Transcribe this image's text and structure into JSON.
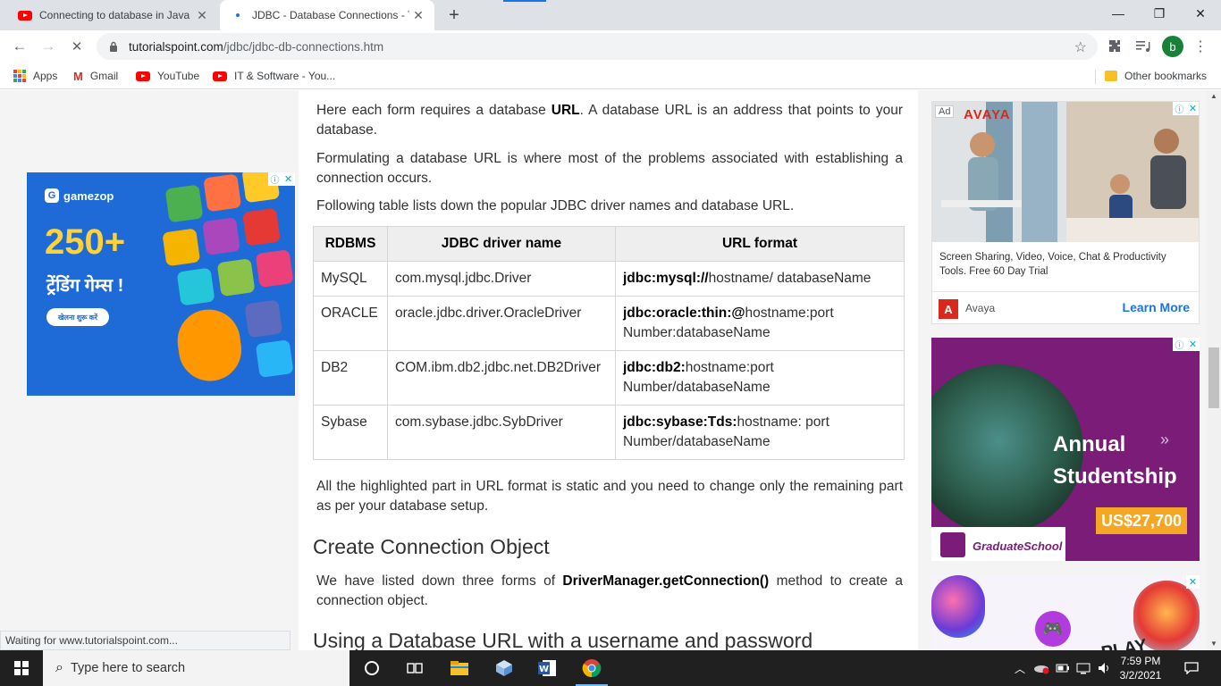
{
  "browser": {
    "tabs": [
      {
        "title": "Connecting to database in Java M",
        "icon": "youtube-icon"
      },
      {
        "title": "JDBC - Database Connections - T",
        "icon": "loading-icon"
      }
    ],
    "new_tab": "+",
    "window_controls": {
      "minimize": "—",
      "maximize": "❐",
      "close": "✕"
    },
    "nav": {
      "back": "←",
      "forward": "→",
      "stop": "✕"
    },
    "url": {
      "host": "tutorialspoint.com",
      "path": "/jdbc/jdbc-db-connections.htm"
    },
    "profile_initial": "b",
    "bookmarks": [
      "Apps",
      "Gmail",
      "YouTube",
      "IT & Software - You..."
    ],
    "other_bookmarks": "Other bookmarks",
    "status_text": "Waiting for www.tutorialspoint.com..."
  },
  "article": {
    "p1": {
      "pre": "Here each form requires a database ",
      "bold": "URL",
      "post": ". A database URL is an address that points to your database."
    },
    "p2": "Formulating a database URL is where most of the problems associated with establishing a connection occurs.",
    "p3": "Following table lists down the popular JDBC driver names and database URL.",
    "table": {
      "headers": [
        "RDBMS",
        "JDBC driver name",
        "URL format"
      ],
      "rows": [
        {
          "rdbms": "MySQL",
          "driver": "com.mysql.jdbc.Driver",
          "url_bold": "jdbc:mysql://",
          "url_rest": "hostname/ databaseName"
        },
        {
          "rdbms": "ORACLE",
          "driver": "oracle.jdbc.driver.OracleDriver",
          "url_bold": "jdbc:oracle:thin:@",
          "url_rest": "hostname:port Number:databaseName"
        },
        {
          "rdbms": "DB2",
          "driver": "COM.ibm.db2.jdbc.net.DB2Driver",
          "url_bold": "jdbc:db2:",
          "url_rest": "hostname:port Number/databaseName"
        },
        {
          "rdbms": "Sybase",
          "driver": "com.sybase.jdbc.SybDriver",
          "url_bold": "jdbc:sybase:Tds:",
          "url_rest": "hostname: port Number/databaseName"
        }
      ]
    },
    "p4": "All the highlighted part in URL format is static and you need to change only the remaining part as per your database setup.",
    "h_create": "Create Connection Object",
    "p5": {
      "pre": "We have listed down three forms of ",
      "bold": "DriverManager.getConnection()",
      "post": " method to create a connection object."
    },
    "h_using": "Using a Database URL with a username and password"
  },
  "ads": {
    "gamezop": {
      "brand": "gamezop",
      "headline": "250+",
      "sub": "ट्रेंडिंग गेम्स !",
      "cta": "खेलना शुरू करें"
    },
    "avaya": {
      "ad_label": "Ad",
      "brand": "AVAYA",
      "text": "Screen Sharing, Video, Voice, Chat & Productivity Tools. Free 60 Day Trial",
      "advertiser": "Avaya",
      "cta": "Learn More"
    },
    "cuhk": {
      "line1": "Annual",
      "line2": "Studentship",
      "price": "US$27,700",
      "school": "GraduateSchool"
    },
    "game": {
      "text": "PLAY"
    }
  },
  "taskbar": {
    "search_placeholder": "Type here to search",
    "time": "7:59 PM",
    "date": "3/2/2021"
  }
}
